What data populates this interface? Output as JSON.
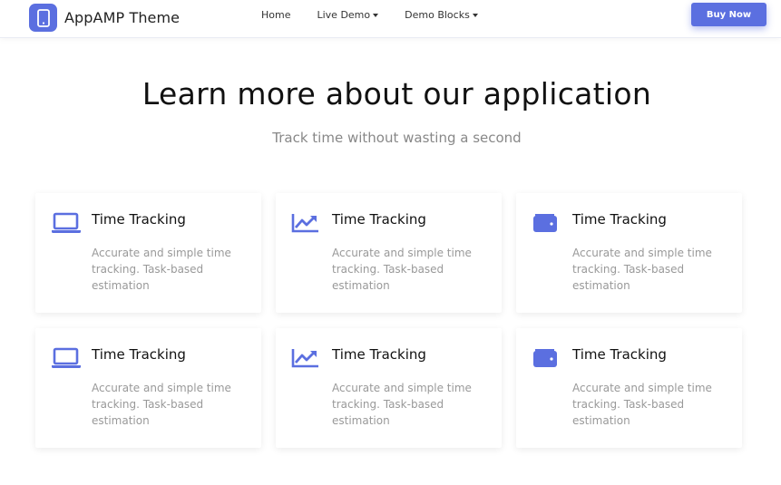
{
  "header": {
    "brand_name": "AppAMP Theme",
    "logo_icon": "phone-icon",
    "nav": [
      {
        "label": "Home"
      },
      {
        "label": "Live Demo"
      },
      {
        "label": "Demo Blocks"
      }
    ],
    "buy_label": "Buy Now"
  },
  "hero": {
    "title": "Learn more about our application",
    "subtitle": "Track time without wasting a second"
  },
  "features": [
    {
      "icon": "laptop-icon",
      "title": "Time Tracking",
      "desc": "Accurate and simple time tracking. Task-based estimation"
    },
    {
      "icon": "chart-line-icon",
      "title": "Time Tracking",
      "desc": "Accurate and simple time tracking. Task-based estimation"
    },
    {
      "icon": "wallet-icon",
      "title": "Time Tracking",
      "desc": "Accurate and simple time tracking. Task-based estimation"
    },
    {
      "icon": "laptop-icon",
      "title": "Time Tracking",
      "desc": "Accurate and simple time tracking. Task-based estimation"
    },
    {
      "icon": "chart-line-icon",
      "title": "Time Tracking",
      "desc": "Accurate and simple time tracking. Task-based estimation"
    },
    {
      "icon": "wallet-icon",
      "title": "Time Tracking",
      "desc": "Accurate and simple time tracking. Task-based estimation"
    }
  ],
  "colors": {
    "accent": "#5b6fe0",
    "text_muted": "#999999"
  }
}
